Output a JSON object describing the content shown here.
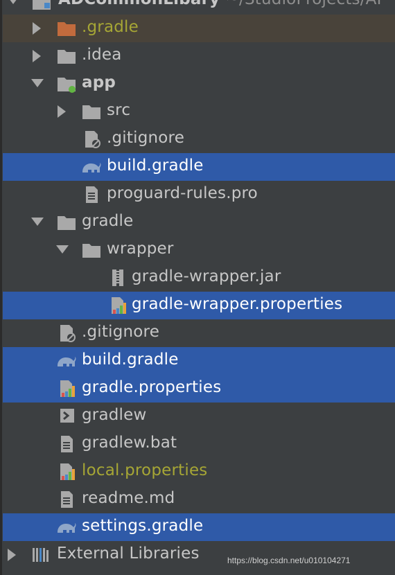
{
  "tree": {
    "root": {
      "name": "ADCommonLibary",
      "path": "~/StudioProjects/AI"
    },
    "items": [
      {
        "label": ".gradle"
      },
      {
        "label": ".idea"
      },
      {
        "label": "app"
      },
      {
        "label": "src"
      },
      {
        "label": ".gitignore"
      },
      {
        "label": "build.gradle"
      },
      {
        "label": "proguard-rules.pro"
      },
      {
        "label": "gradle"
      },
      {
        "label": "wrapper"
      },
      {
        "label": "gradle-wrapper.jar"
      },
      {
        "label": "gradle-wrapper.properties"
      },
      {
        "label": ".gitignore"
      },
      {
        "label": "build.gradle"
      },
      {
        "label": "gradle.properties"
      },
      {
        "label": "gradlew"
      },
      {
        "label": "gradlew.bat"
      },
      {
        "label": "local.properties"
      },
      {
        "label": "readme.md"
      },
      {
        "label": "settings.gradle"
      },
      {
        "label": "External Libraries"
      }
    ]
  },
  "watermark": "https://blog.csdn.net/u010104271",
  "colors": {
    "background": "#3c3f41",
    "selection": "#2f5aa8",
    "text": "#c7c7c7",
    "excluded_text": "#a6a635",
    "folder": "#a9a9a9",
    "excluded_folder": "#c26b3d"
  }
}
